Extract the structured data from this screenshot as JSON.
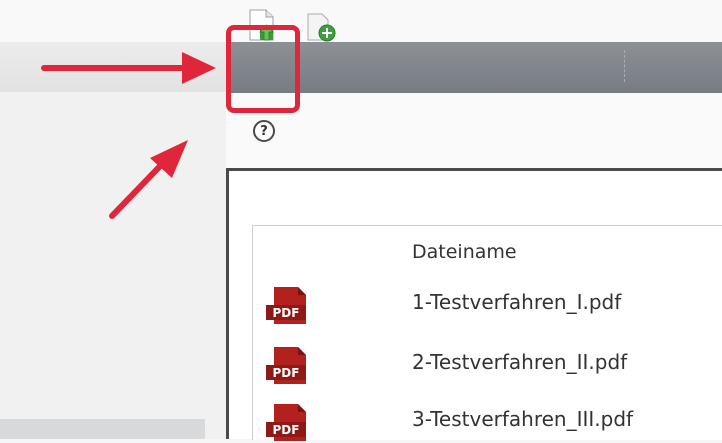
{
  "toolbar": {
    "buttons": [
      {
        "name": "upload-file-button",
        "icon": "document-upload-icon"
      },
      {
        "name": "add-file-button",
        "icon": "add-document-icon"
      }
    ]
  },
  "help": {
    "label": "?"
  },
  "table": {
    "column_header": "Dateiname",
    "files": [
      {
        "icon": "pdf-icon",
        "icon_text": "PDF",
        "name": "1-Testverfahren_I.pdf"
      },
      {
        "icon": "pdf-icon",
        "icon_text": "PDF",
        "name": "2-Testverfahren_II.pdf"
      },
      {
        "icon": "pdf-icon",
        "icon_text": "PDF",
        "name": "3-Testverfahren_III.pdf"
      }
    ]
  },
  "annotations": {
    "color": "#e0263b"
  }
}
